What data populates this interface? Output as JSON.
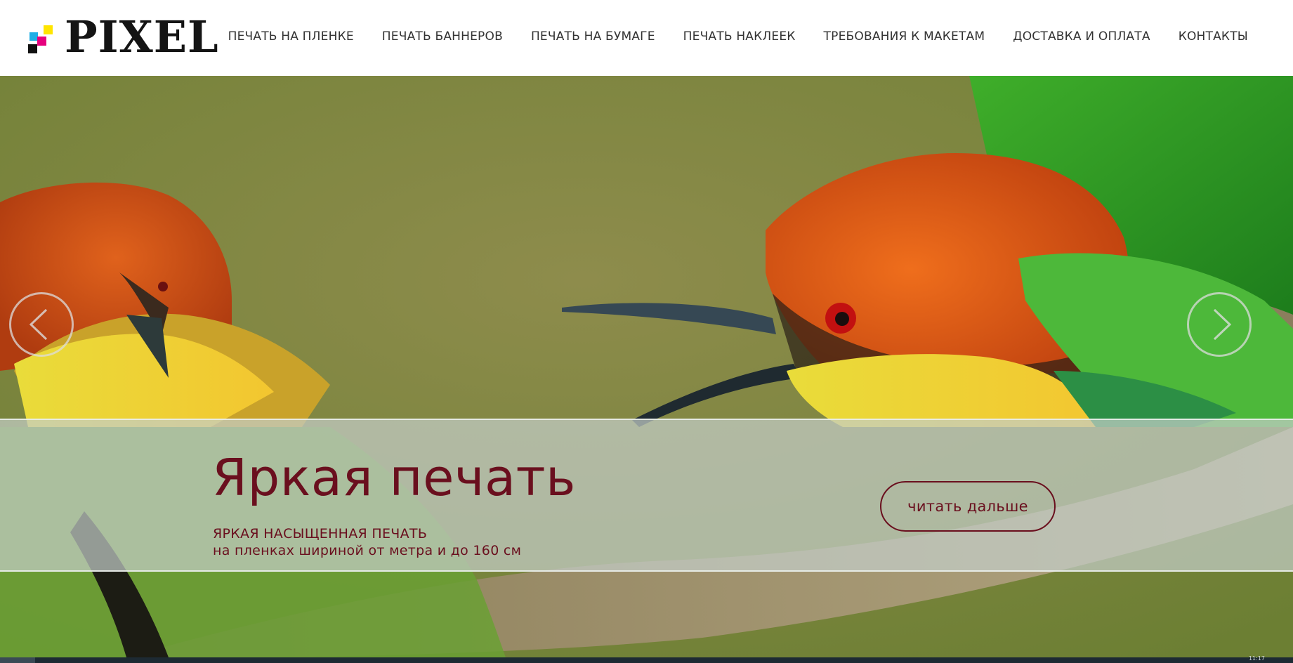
{
  "header": {
    "logo_text": "PIXEL",
    "nav": [
      {
        "label": "ПЕЧАТЬ НА ПЛЕНКЕ"
      },
      {
        "label": "ПЕЧАТЬ БАННЕРОВ"
      },
      {
        "label": "ПЕЧАТЬ НА БУМАГЕ"
      },
      {
        "label": "ПЕЧАТЬ НАКЛЕЕК"
      },
      {
        "label": "ТРЕБОВАНИЯ К МАКЕТАМ"
      },
      {
        "label": "ДОСТАВКА И ОПЛАТА"
      },
      {
        "label": "КОНТАКТЫ"
      }
    ]
  },
  "slider": {
    "title": "Яркая печать",
    "subtitle_line1": "ЯРКАЯ НАСЫЩЕННАЯ ПЕЧАТЬ",
    "subtitle_line2": "на пленках шириной от метра и до 160 см",
    "read_more_label": "читать дальше",
    "prev_icon": "chevron-left-icon",
    "next_icon": "chevron-right-icon"
  },
  "taskbar": {
    "clock": "11:17"
  },
  "colors": {
    "accent": "#6a0f1e",
    "logo_yellow": "#ffe500",
    "logo_cyan": "#1eaee6",
    "logo_magenta": "#e6007e",
    "logo_black": "#111111"
  }
}
